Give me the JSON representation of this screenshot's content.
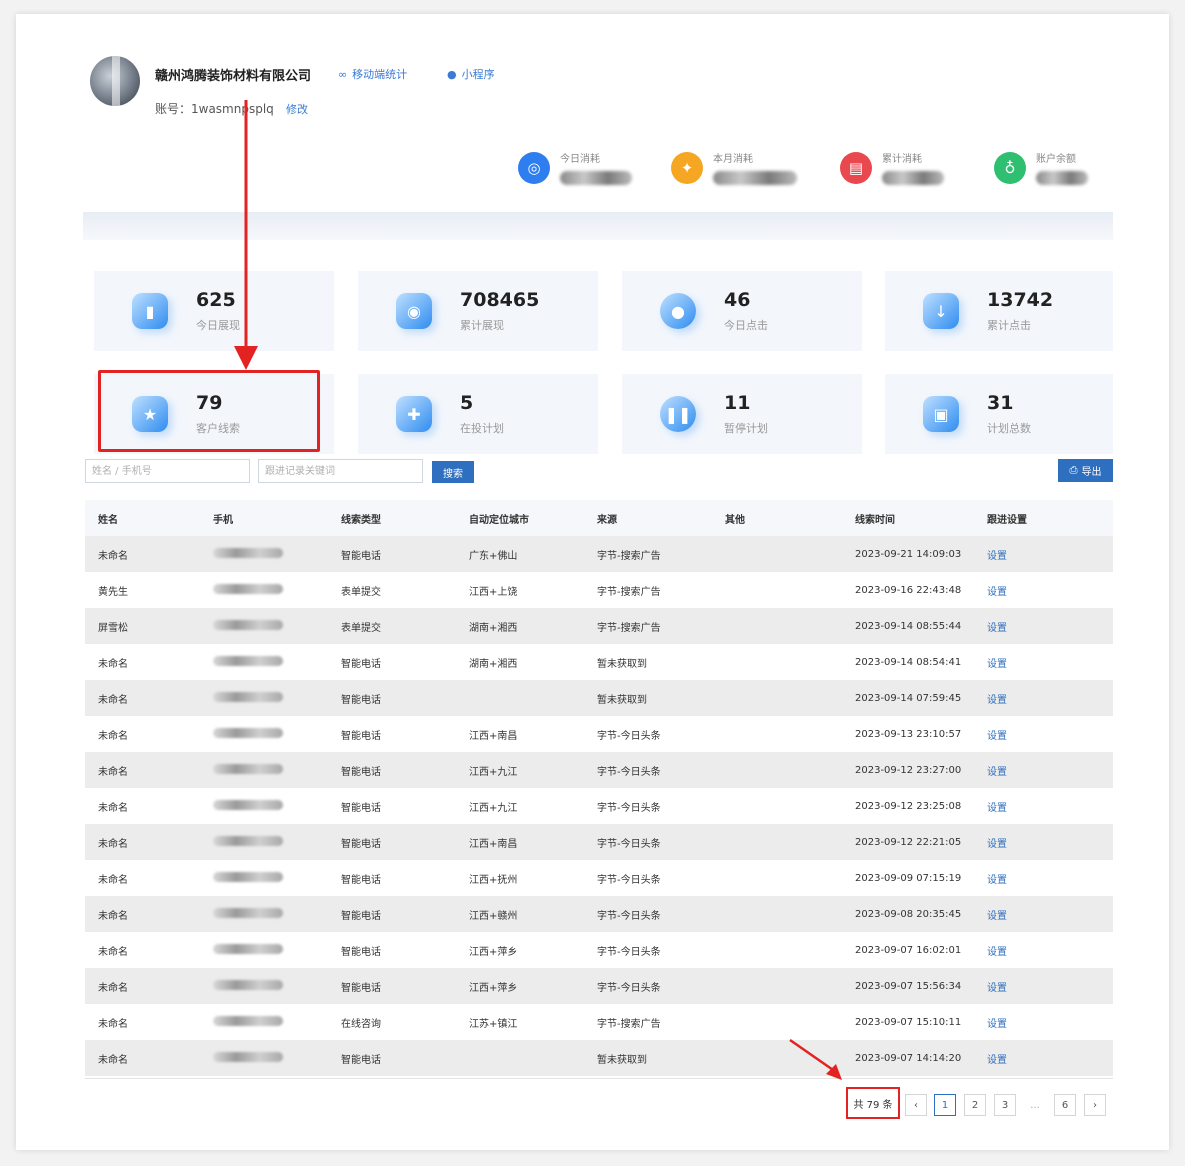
{
  "header": {
    "company": "赣州鸿腾装饰材料有限公司",
    "mobile_stats": "移动端统计",
    "mini_program": "小程序",
    "account": "账号：1wasmnpsplq",
    "modify": "修改"
  },
  "top_stats": [
    {
      "label": "今日消耗",
      "color": "#2f7ef0",
      "icon": "coins-icon"
    },
    {
      "label": "本月消耗",
      "color": "#f5a623",
      "icon": "calendar-icon"
    },
    {
      "label": "累计消耗",
      "color": "#e8484e",
      "icon": "stack-icon"
    },
    {
      "label": "账户余额",
      "color": "#2fbf71",
      "icon": "money-bag-icon"
    }
  ],
  "cards": [
    {
      "value": "625",
      "label": "今日展现"
    },
    {
      "value": "708465",
      "label": "累计展现"
    },
    {
      "value": "46",
      "label": "今日点击"
    },
    {
      "value": "13742",
      "label": "累计点击"
    },
    {
      "value": "79",
      "label": "客户线索"
    },
    {
      "value": "5",
      "label": "在投计划"
    },
    {
      "value": "11",
      "label": "暂停计划"
    },
    {
      "value": "31",
      "label": "计划总数"
    }
  ],
  "search": {
    "name_placeholder": "姓名 / 手机号",
    "keyword_placeholder": "跟进记录关键词",
    "search_button": "搜索",
    "export_button": "导出"
  },
  "table": {
    "headers": [
      "姓名",
      "手机",
      "线索类型",
      "自动定位城市",
      "来源",
      "其他",
      "线索时间",
      "跟进设置"
    ],
    "rows": [
      {
        "name": "未命名",
        "type": "智能电话",
        "city": "广东+佛山",
        "source": "字节-搜索广告",
        "other": "",
        "time": "2023-09-21 14:09:03",
        "action": "设置"
      },
      {
        "name": "黄先生",
        "type": "表单提交",
        "city": "江西+上饶",
        "source": "字节-搜索广告",
        "other": "",
        "time": "2023-09-16 22:43:48",
        "action": "设置"
      },
      {
        "name": "屏雪松",
        "type": "表单提交",
        "city": "湖南+湘西",
        "source": "字节-搜索广告",
        "other": "",
        "time": "2023-09-14 08:55:44",
        "action": "设置"
      },
      {
        "name": "未命名",
        "type": "智能电话",
        "city": "湖南+湘西",
        "source": "暂未获取到",
        "other": "",
        "time": "2023-09-14 08:54:41",
        "action": "设置"
      },
      {
        "name": "未命名",
        "type": "智能电话",
        "city": "",
        "source": "暂未获取到",
        "other": "",
        "time": "2023-09-14 07:59:45",
        "action": "设置"
      },
      {
        "name": "未命名",
        "type": "智能电话",
        "city": "江西+南昌",
        "source": "字节-今日头条",
        "other": "",
        "time": "2023-09-13 23:10:57",
        "action": "设置"
      },
      {
        "name": "未命名",
        "type": "智能电话",
        "city": "江西+九江",
        "source": "字节-今日头条",
        "other": "",
        "time": "2023-09-12 23:27:00",
        "action": "设置"
      },
      {
        "name": "未命名",
        "type": "智能电话",
        "city": "江西+九江",
        "source": "字节-今日头条",
        "other": "",
        "time": "2023-09-12 23:25:08",
        "action": "设置"
      },
      {
        "name": "未命名",
        "type": "智能电话",
        "city": "江西+南昌",
        "source": "字节-今日头条",
        "other": "",
        "time": "2023-09-12 22:21:05",
        "action": "设置"
      },
      {
        "name": "未命名",
        "type": "智能电话",
        "city": "江西+抚州",
        "source": "字节-今日头条",
        "other": "",
        "time": "2023-09-09 07:15:19",
        "action": "设置"
      },
      {
        "name": "未命名",
        "type": "智能电话",
        "city": "江西+赣州",
        "source": "字节-今日头条",
        "other": "",
        "time": "2023-09-08 20:35:45",
        "action": "设置"
      },
      {
        "name": "未命名",
        "type": "智能电话",
        "city": "江西+萍乡",
        "source": "字节-今日头条",
        "other": "",
        "time": "2023-09-07 16:02:01",
        "action": "设置"
      },
      {
        "name": "未命名",
        "type": "智能电话",
        "city": "江西+萍乡",
        "source": "字节-今日头条",
        "other": "",
        "time": "2023-09-07 15:56:34",
        "action": "设置"
      },
      {
        "name": "未命名",
        "type": "在线咨询",
        "city": "江苏+镇江",
        "source": "字节-搜索广告",
        "other": "",
        "time": "2023-09-07 15:10:11",
        "action": "设置"
      },
      {
        "name": "未命名",
        "type": "智能电话",
        "city": "",
        "source": "暂未获取到",
        "other": "",
        "time": "2023-09-07 14:14:20",
        "action": "设置"
      }
    ]
  },
  "pagination": {
    "total": "共 79 条",
    "prev": "‹",
    "pages": [
      "1",
      "2",
      "3",
      "...",
      "6"
    ],
    "next": "›"
  },
  "annotation_color": "#e32222"
}
